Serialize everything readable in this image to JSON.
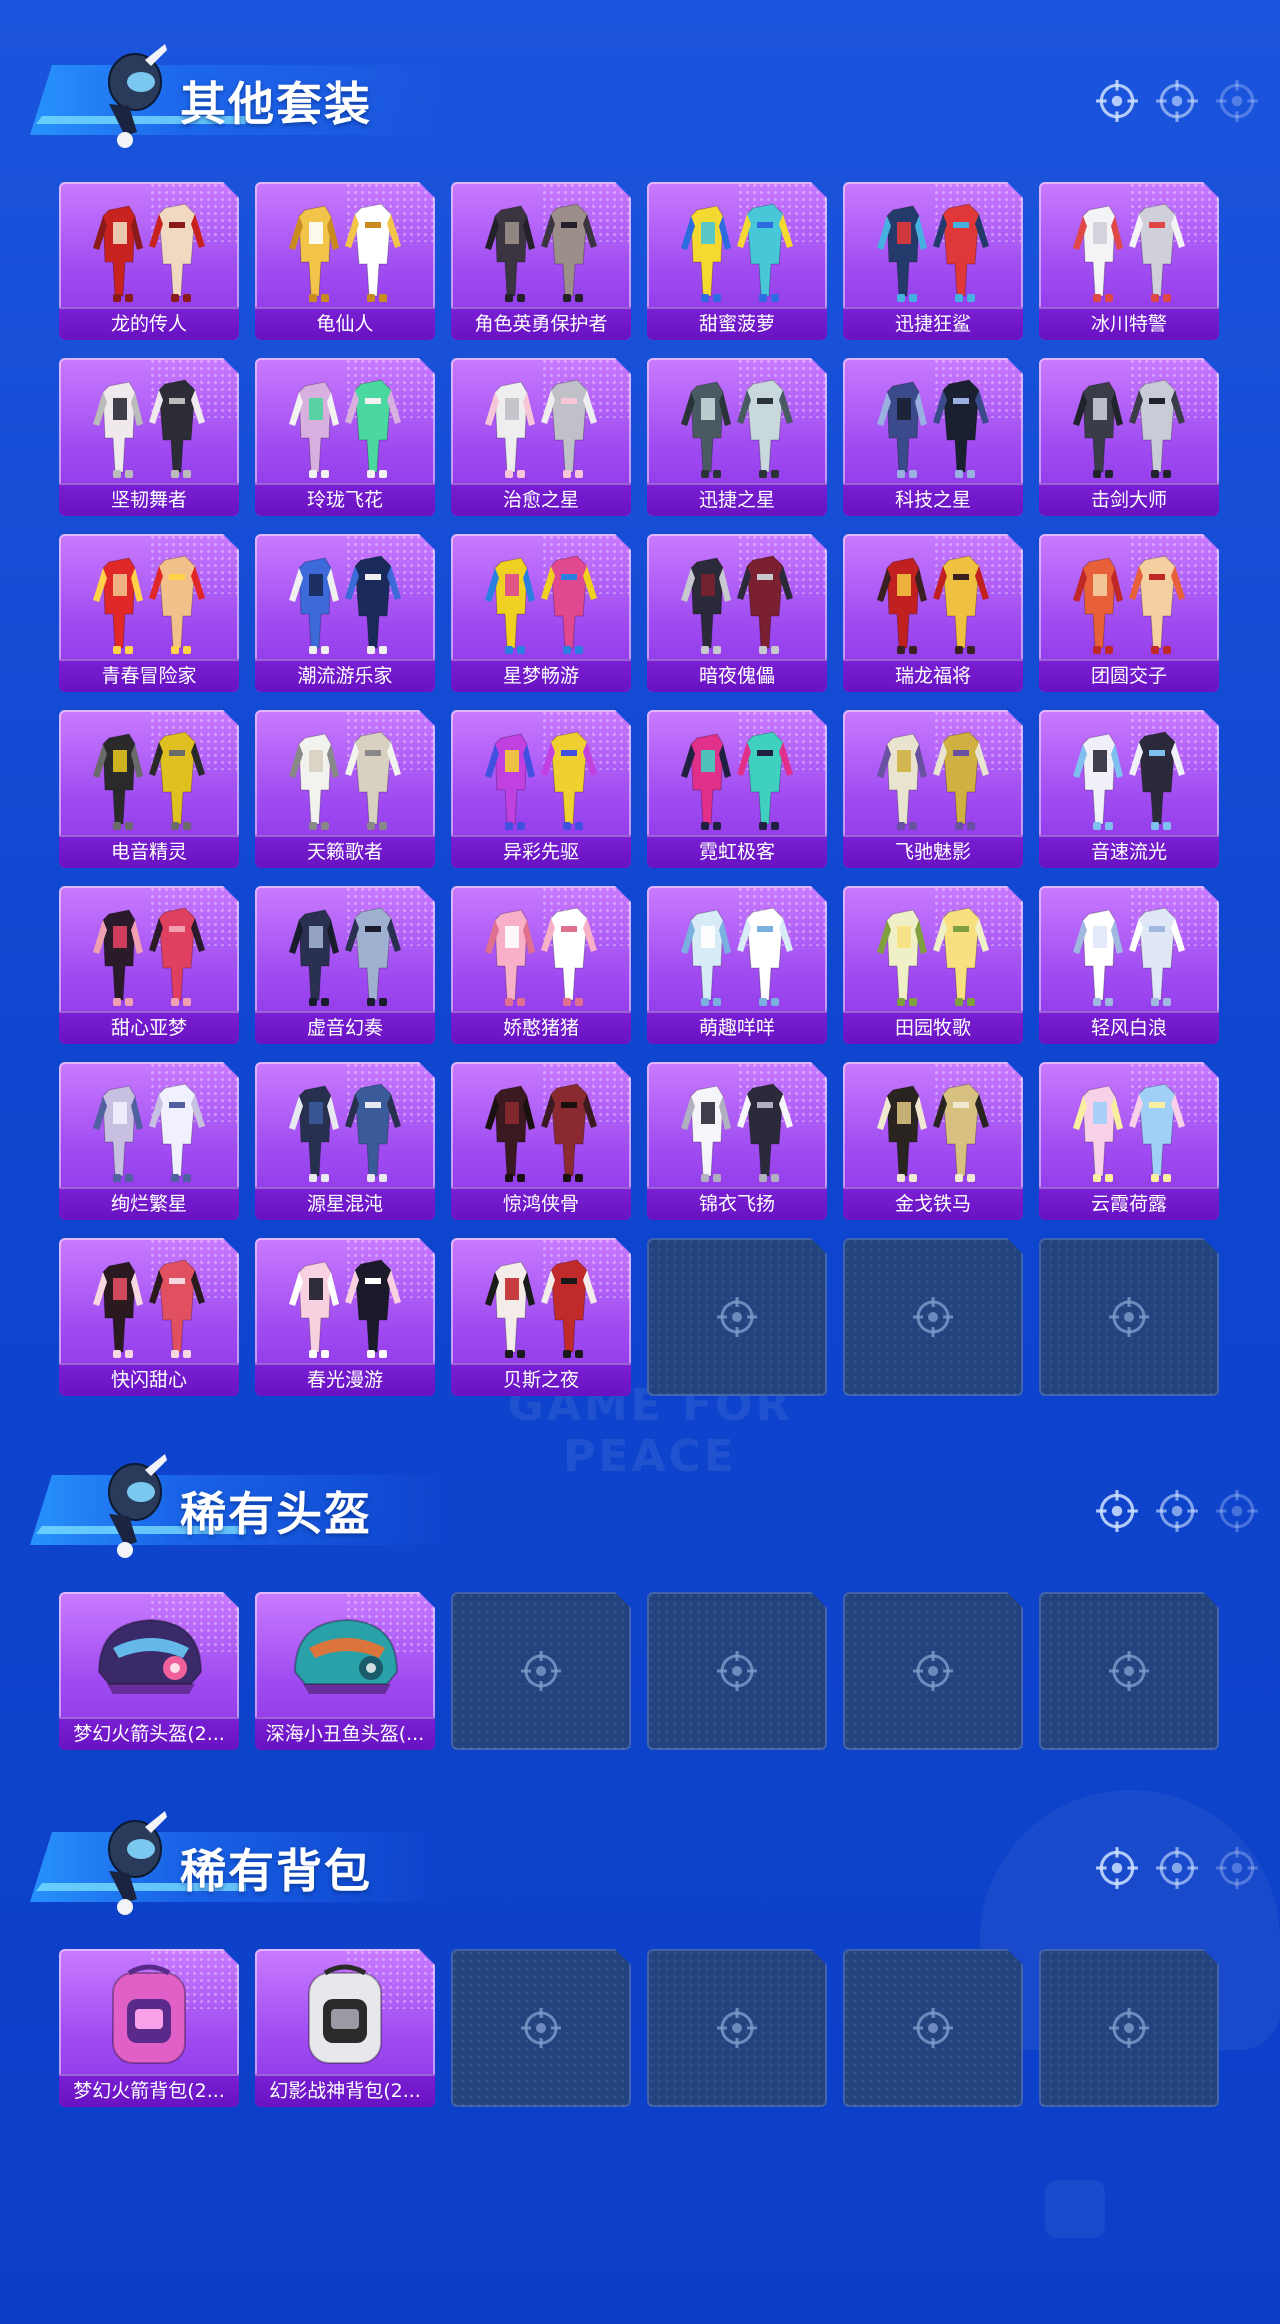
{
  "sections": [
    {
      "title": "其他套装",
      "items": [
        "龙的传人",
        "龟仙人",
        "角色英勇保护者",
        "甜蜜菠萝",
        "迅捷狂鲨",
        "冰川特警",
        "坚韧舞者",
        "玲珑飞花",
        "治愈之星",
        "迅捷之星",
        "科技之星",
        "击剑大师",
        "青春冒险家",
        "潮流游乐家",
        "星梦畅游",
        "暗夜傀儡",
        "瑞龙福将",
        "团圆交子",
        "电音精灵",
        "天籁歌者",
        "异彩先驱",
        "霓虹极客",
        "飞驰魅影",
        "音速流光",
        "甜心亚梦",
        "虚音幻奏",
        "娇憨猪猪",
        "萌趣咩咩",
        "田园牧歌",
        "轻风白浪",
        "绚烂繁星",
        "源星混沌",
        "惊鸿侠骨",
        "锦衣飞扬",
        "金戈铁马",
        "云霞荷露",
        "快闪甜心",
        "春光漫游",
        "贝斯之夜"
      ],
      "empty_slots": 3
    },
    {
      "title": "稀有头盔",
      "items": [
        "梦幻火箭头盔(2...",
        "深海小丑鱼头盔(..."
      ],
      "empty_slots": 4
    },
    {
      "title": "稀有背包",
      "items": [
        "梦幻火箭背包(2...",
        "幻影战神背包(2..."
      ],
      "empty_slots": 4
    }
  ],
  "watermark": "GAME FOR PEACE",
  "colors": {
    "background": "#1447d4",
    "card_purple": "#a04cf1",
    "label_purple": "#6812c2",
    "empty_slot": "#23437e"
  }
}
